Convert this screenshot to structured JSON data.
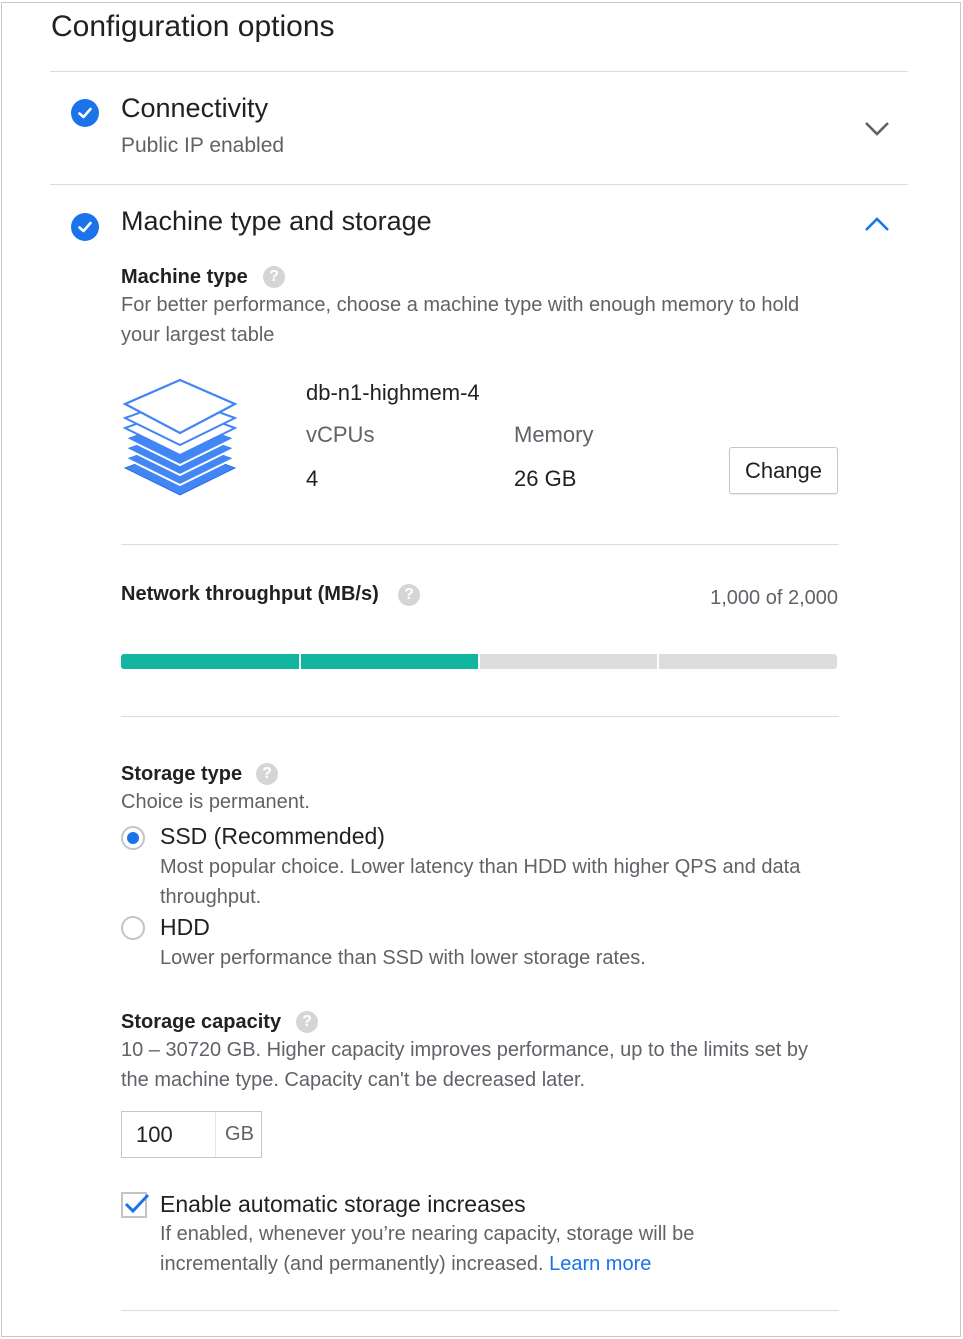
{
  "page": {
    "title": "Configuration options"
  },
  "connectivity": {
    "title": "Connectivity",
    "subtitle": "Public IP enabled",
    "expanded": false
  },
  "machine_storage": {
    "title": "Machine type and storage",
    "expanded": true,
    "machine_type": {
      "label": "Machine type",
      "description": "For better performance, choose a machine type with enough memory to hold your largest table",
      "name": "db-n1-highmem-4",
      "vcpus_label": "vCPUs",
      "vcpus_value": "4",
      "memory_label": "Memory",
      "memory_value": "26 GB",
      "change_button": "Change"
    },
    "network": {
      "label": "Network throughput (MB/s)",
      "value_text": "1,000 of 2,000",
      "fill_fraction": 0.5,
      "segments": 4,
      "fill_color": "#12b5a1",
      "track_color": "#dddddd"
    },
    "storage_type": {
      "label": "Storage type",
      "note": "Choice is permanent.",
      "options": [
        {
          "label": "SSD (Recommended)",
          "description": "Most popular choice. Lower latency than HDD with higher QPS and data throughput.",
          "selected": true
        },
        {
          "label": "HDD",
          "description": "Lower performance than SSD with lower storage rates.",
          "selected": false
        }
      ]
    },
    "storage_capacity": {
      "label": "Storage capacity",
      "description": "10 – 30720 GB. Higher capacity improves performance, up to the limits set by the machine type. Capacity can't be decreased later.",
      "value": "100",
      "unit": "GB"
    },
    "auto_increase": {
      "label": "Enable automatic storage increases",
      "checked": true,
      "description": "If enabled, whenever you’re nearing capacity, storage will be incrementally (and permanently) increased.",
      "link": "Learn more"
    }
  },
  "colors": {
    "accent": "#1a73e8",
    "bar_fill": "#12b5a1",
    "text_primary": "#202124",
    "text_secondary": "#5f6368",
    "divider": "#dadce0"
  },
  "icons": [
    "check-circle-icon",
    "chevron-down-icon",
    "chevron-up-icon",
    "help-icon",
    "stacked-layers-icon",
    "checkmark-icon"
  ]
}
